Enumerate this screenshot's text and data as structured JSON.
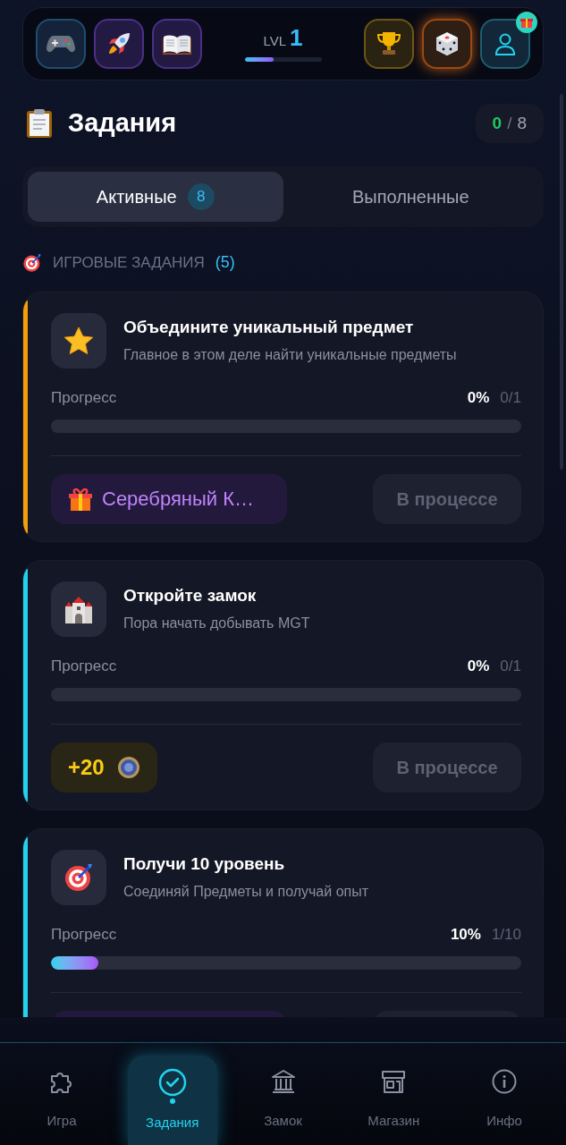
{
  "header": {
    "left_buttons": [
      {
        "kind": "gamepad"
      },
      {
        "kind": "rocket"
      },
      {
        "kind": "book"
      }
    ],
    "level": {
      "label": "LVL",
      "value": "1",
      "level": 0.38
    },
    "right_buttons": [
      {
        "kind": "trophy",
        "gift_badge": false
      },
      {
        "kind": "dice",
        "gift_badge": false
      },
      {
        "kind": "user",
        "gift_badge": true
      }
    ]
  },
  "title": {
    "text": "Задания",
    "done": "0",
    "separator": "/",
    "total": "8"
  },
  "tabs": [
    {
      "label": "Активные",
      "count": "8",
      "selected": true
    },
    {
      "label": "Выполненные",
      "selected": false
    }
  ],
  "section": {
    "title": "ИГРОВЫЕ ЗАДАНИЯ",
    "count": "(5)"
  },
  "tasks": [
    {
      "kind": "star",
      "color": "#f59e0b",
      "title": "Объедините уникальный предмет",
      "description": "Главное в этом деле найти уникальные предметы",
      "progress_label": "Прогресс",
      "percent": "0%",
      "count": "0/1",
      "level": 0,
      "reward": {
        "kind": "item",
        "label": "Серебряный К…"
      },
      "status": "В процессе"
    },
    {
      "kind": "castle",
      "color": "#22d3ee",
      "title": "Откройте замок",
      "description": "Пора начать добывать MGT",
      "progress_label": "Прогресс",
      "percent": "0%",
      "count": "0/1",
      "level": 0,
      "reward": {
        "kind": "coins",
        "label": "+20"
      },
      "status": "В процессе"
    },
    {
      "kind": "target",
      "color": "#22d3ee",
      "title": "Получи 10 уровень",
      "description": "Соединяй Предметы и получай опыт",
      "progress_label": "Прогресс",
      "percent": "10%",
      "count": "1/10",
      "level": 0.1,
      "reward": {
        "kind": "item"
      }
    }
  ],
  "nav": [
    {
      "kind": "puzzle",
      "label": "Игра",
      "selected": false
    },
    {
      "kind": "check",
      "label": "Задания",
      "selected": true
    },
    {
      "kind": "bank",
      "label": "Замок",
      "selected": false
    },
    {
      "kind": "store",
      "label": "Магазин",
      "selected": false
    },
    {
      "kind": "info",
      "label": "Инфо",
      "selected": false
    }
  ]
}
